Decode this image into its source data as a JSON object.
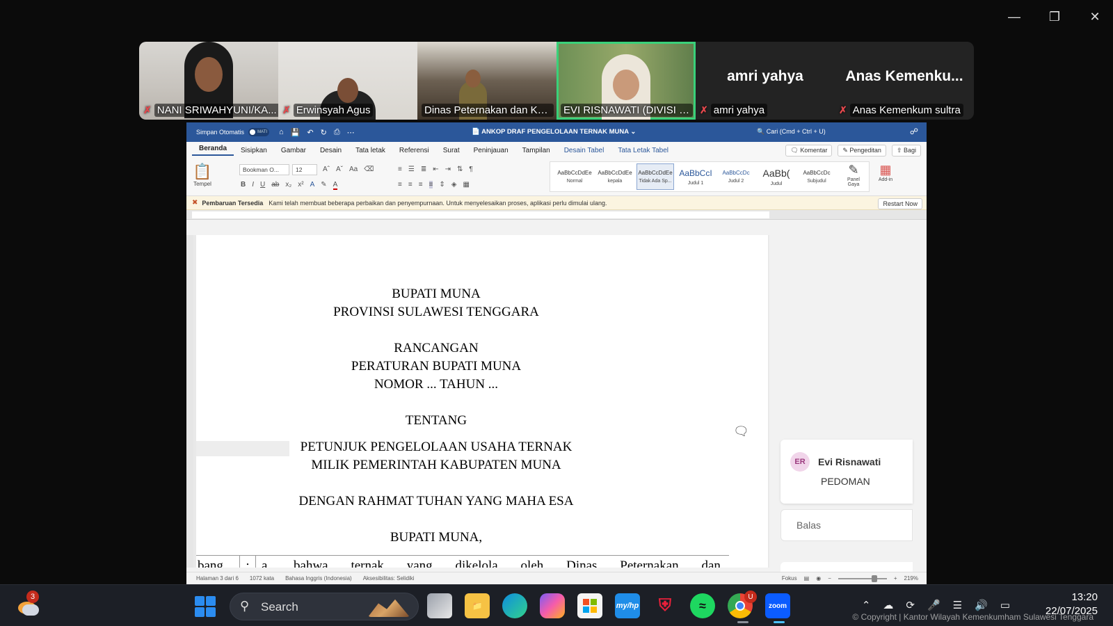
{
  "gallery": {
    "participants": [
      {
        "name": "NANI SRIWAHYUNI/KA...",
        "muted": true
      },
      {
        "name": "Erwinsyah Agus",
        "muted": true
      },
      {
        "name": "Dinas Peternakan dan Kes...",
        "muted": false
      },
      {
        "name": "EVI RISNAWATI (DIVISI P3...",
        "muted": false,
        "active_speaker": true
      },
      {
        "name": "amri yahya",
        "display_big": "amri yahya",
        "muted": true
      },
      {
        "name": "Anas Kemenkum sultra",
        "display_big": "Anas  Kemenku...",
        "muted": true
      }
    ]
  },
  "word": {
    "autosave_label": "Simpan Otomatis",
    "autosave_state": "MATI",
    "document_title": "ANKOP DRAF PENGELOLAAN TERNAK MUNA",
    "search_placeholder": "Cari (Cmd + Ctrl + U)",
    "tabs": [
      "Beranda",
      "Sisipkan",
      "Gambar",
      "Desain",
      "Tata letak",
      "Referensi",
      "Surat",
      "Peninjauan",
      "Tampilan"
    ],
    "context_tabs": [
      "Desain Tabel",
      "Tata Letak Tabel"
    ],
    "tab_buttons": {
      "comment": "Komentar",
      "editing": "Pengeditan",
      "share": "Bagi"
    },
    "ribbon": {
      "paste": "Tempel",
      "font": "Bookman O...",
      "size": "12",
      "styles": [
        {
          "sample": "AaBbCcDdEe",
          "name": "Normal"
        },
        {
          "sample": "AaBbCcDdEe",
          "name": "kepala"
        },
        {
          "sample": "AaBbCcDdEe",
          "name": "Tidak Ada Sp..."
        },
        {
          "sample": "AaBbCcI",
          "name": "Judul 1"
        },
        {
          "sample": "AaBbCcDc",
          "name": "Judul 2"
        },
        {
          "sample": "AaBb(",
          "name": "Judul"
        },
        {
          "sample": "AaBbCcDc",
          "name": "Subjudul"
        }
      ],
      "panel_gaya": "Panel Gaya",
      "addin": "Add-in"
    },
    "notice": {
      "title": "Pembaruan Tersedia",
      "message": "Kami telah membuat beberapa perbaikan dan penyempurnaan. Untuk menyelesaikan proses, aplikasi perlu dimulai ulang.",
      "button": "Restart Now"
    },
    "document_lines": [
      "BUPATI MUNA",
      "PROVINSI SULAWESI TENGGARA",
      "RANCANGAN",
      "PERATURAN BUPATI MUNA",
      "NOMOR ... TAHUN ...",
      "TENTANG",
      "PETUNJUK PENGELOLAAN USAHA TERNAK",
      "MILIK PEMERINTAH KABUPATEN MUNA",
      "DENGAN RAHMAT TUHAN YANG MAHA ESA",
      "BUPATI MUNA,"
    ],
    "table_row": {
      "col1": "bang",
      "col2": ":",
      "words": [
        "a.",
        "bahwa",
        "ternak",
        "yang",
        "dikelola",
        "oleh",
        "Dinas",
        "Peternakan",
        "dan"
      ]
    },
    "comment": {
      "initials": "ER",
      "author": "Evi Risnawati",
      "text": "PEDOMAN",
      "reply_placeholder": "Balas"
    },
    "status": {
      "page": "Halaman 3 dari 6",
      "words": "1072 kata",
      "language": "Bahasa Inggris (Indonesia)",
      "accessibility": "Aksesibilitas: Selidiki",
      "focus": "Fokus",
      "zoom": "219%"
    }
  },
  "taskbar": {
    "weather_badge": "3",
    "search_label": "Search",
    "chrome_badge": "U",
    "time": "13:20",
    "date": "22/07/2025"
  },
  "watermark": "© Copyright | Kantor Wilayah Kemenkumham Sulawesi Tenggara"
}
